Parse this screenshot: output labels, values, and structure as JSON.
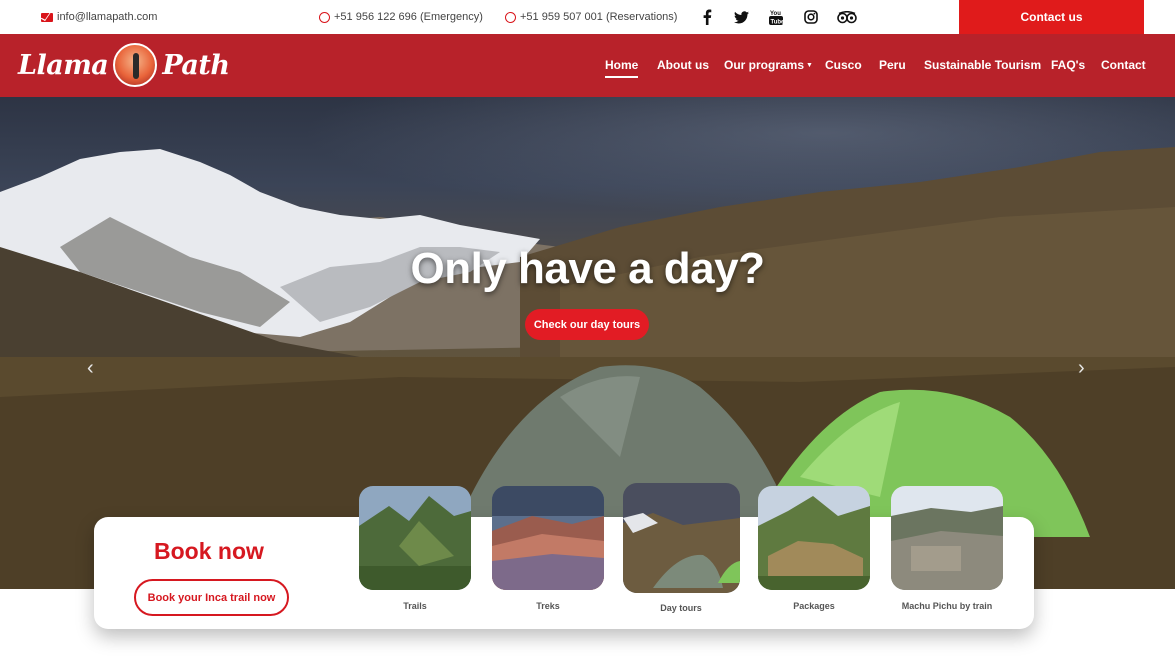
{
  "topbar": {
    "email": "info@llamapath.com",
    "phone_emergency": "+51 956 122 696 (Emergency)",
    "phone_reservations": "+51 959 507 001 (Reservations)",
    "contact_button": "Contact us",
    "social_icons": [
      "facebook-icon",
      "twitter-icon",
      "youtube-icon",
      "instagram-icon",
      "tripadvisor-icon"
    ]
  },
  "brand": {
    "left": "Llama",
    "right": "Path"
  },
  "nav": {
    "items": [
      {
        "label": "Home"
      },
      {
        "label": "About us"
      },
      {
        "label": "Our programs"
      },
      {
        "label": "Cusco"
      },
      {
        "label": "Peru"
      },
      {
        "label": "Sustainable Tourism"
      },
      {
        "label": "FAQ's"
      },
      {
        "label": "Contact"
      }
    ]
  },
  "hero": {
    "title": "Only have a day?",
    "cta": "Check our day tours"
  },
  "booking": {
    "title": "Book now",
    "button": "Book your Inca trail now",
    "cards": [
      {
        "label": "Trails"
      },
      {
        "label": "Treks"
      },
      {
        "label": "Day tours"
      },
      {
        "label": "Packages"
      },
      {
        "label": "Machu Pichu by train"
      }
    ]
  },
  "colors": {
    "brand_red": "#b8222a",
    "accent_red": "#e01b1b"
  }
}
